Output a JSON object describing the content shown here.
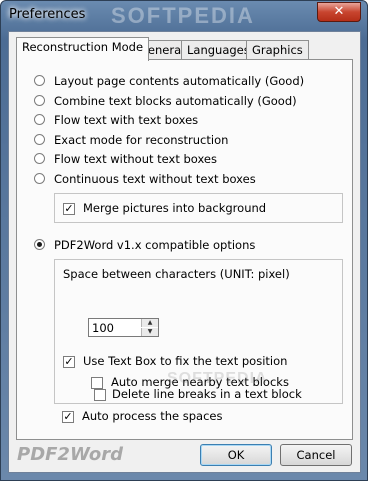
{
  "window": {
    "title": "Preferences",
    "close_glyph": "✕",
    "watermark": "SOFTPEDIA"
  },
  "tabs": [
    {
      "label": "Reconstruction Mode",
      "active": true
    },
    {
      "label": "General",
      "active": false
    },
    {
      "label": "Languages",
      "active": false
    },
    {
      "label": "Graphics",
      "active": false
    }
  ],
  "options": [
    {
      "label": "Layout page contents automatically (Good)",
      "selected": false
    },
    {
      "label": "Combine text blocks automatically (Good)",
      "selected": false
    },
    {
      "label": "Flow text with text boxes",
      "selected": false
    },
    {
      "label": "Exact mode for reconstruction",
      "selected": false
    },
    {
      "label": "Flow text without text boxes",
      "selected": false
    },
    {
      "label": "Continuous text without text boxes",
      "selected": false
    }
  ],
  "merge_pictures": {
    "label": "Merge pictures into background",
    "checked": true
  },
  "compat_option": {
    "label": "PDF2Word v1.x compatible options",
    "selected": true
  },
  "spacing": {
    "label": "Space between characters (UNIT: pixel)",
    "value": "100"
  },
  "checkboxes": {
    "use_text_box": {
      "label": "Use Text Box to fix the text position",
      "checked": true
    },
    "auto_merge": {
      "label": "Auto merge nearby text blocks",
      "checked": false
    },
    "delete_breaks": {
      "label": "Delete line breaks in a text block",
      "checked": false
    },
    "auto_process": {
      "label": "Auto process the spaces",
      "checked": true
    }
  },
  "footer": {
    "logo": "PDF2Word",
    "ok_label": "OK",
    "cancel_label": "Cancel"
  },
  "watermark_mid": "SOFTPEDIA",
  "colors": {
    "title_bar": "#4c6c94",
    "close_button": "#c8452f",
    "ok_focus": "#3c7fb1"
  }
}
